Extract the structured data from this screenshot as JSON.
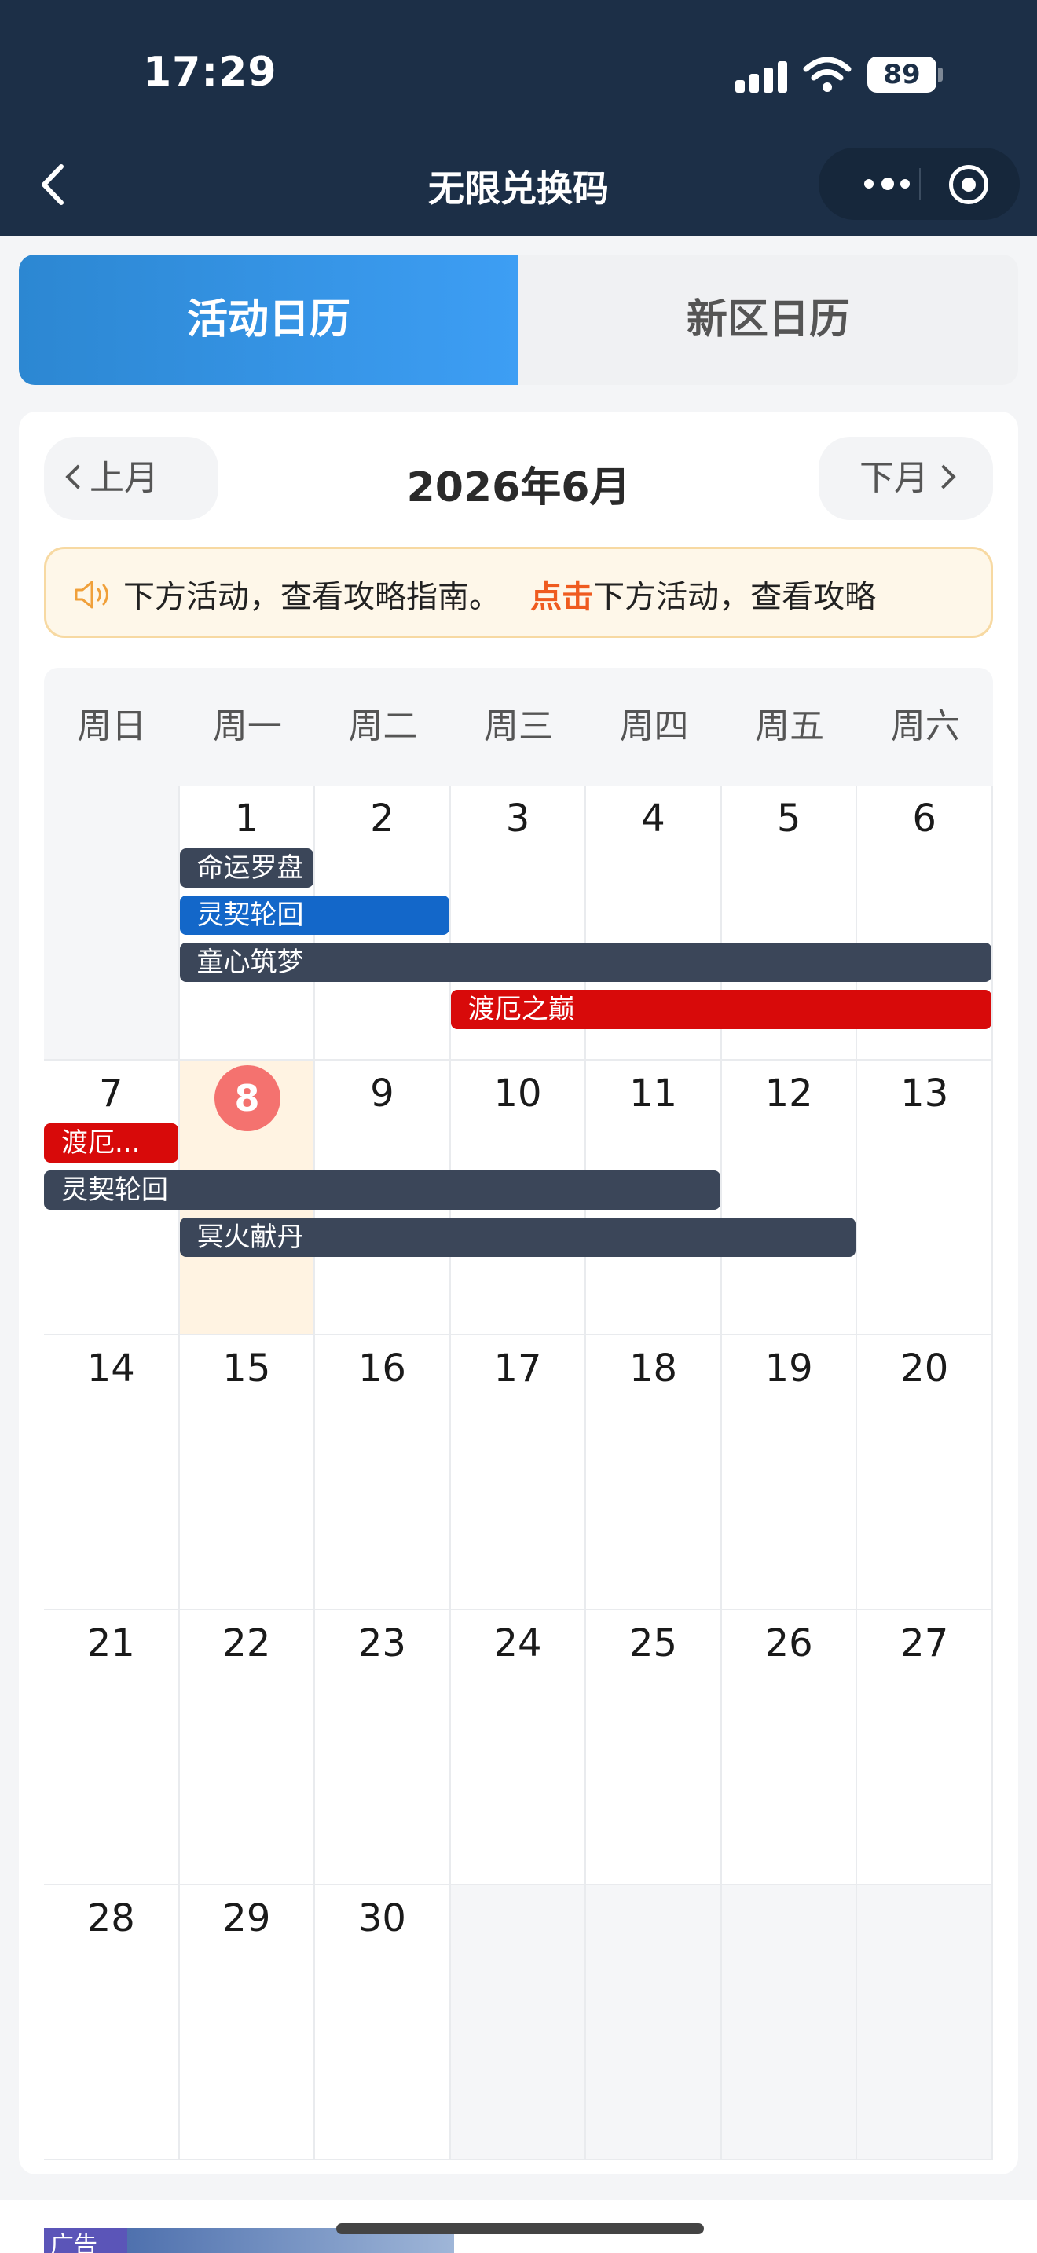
{
  "status": {
    "time": "17:29",
    "battery": "89"
  },
  "nav": {
    "title": "无限兑换码"
  },
  "tabs": [
    {
      "label": "活动日历",
      "active": true
    },
    {
      "label": "新区日历",
      "active": false
    }
  ],
  "calendar": {
    "prev_label": "上月",
    "next_label": "下月",
    "month_title": "2026年6月",
    "notice": {
      "lead": "下方活动，查看攻略指南。",
      "highlight": "点击",
      "tail": "下方活动，查看攻略"
    },
    "weekdays": [
      "周日",
      "周一",
      "周二",
      "周三",
      "周四",
      "周五",
      "周六"
    ],
    "weeks": [
      [
        "",
        "1",
        "2",
        "3",
        "4",
        "5",
        "6"
      ],
      [
        "7",
        "8",
        "9",
        "10",
        "11",
        "12",
        "13"
      ],
      [
        "14",
        "15",
        "16",
        "17",
        "18",
        "19",
        "20"
      ],
      [
        "21",
        "22",
        "23",
        "24",
        "25",
        "26",
        "27"
      ],
      [
        "28",
        "29",
        "30",
        "",
        "",
        "",
        ""
      ]
    ],
    "today": "8",
    "events": [
      {
        "name": "命运罗盘",
        "week": 0,
        "start": 1,
        "end": 2,
        "lane": 0,
        "color": "#3b4659"
      },
      {
        "name": "灵契轮回",
        "week": 0,
        "start": 1,
        "end": 3,
        "lane": 1,
        "color": "#1367c9"
      },
      {
        "name": "童心筑梦",
        "week": 0,
        "start": 1,
        "end": 7,
        "lane": 2,
        "color": "#3b4659"
      },
      {
        "name": "渡厄之巅",
        "week": 0,
        "start": 3,
        "end": 7,
        "lane": 3,
        "color": "#d80a0a"
      },
      {
        "name": "渡厄...",
        "week": 1,
        "start": 0,
        "end": 1,
        "lane": 0,
        "color": "#d80a0a"
      },
      {
        "name": "灵契轮回",
        "week": 1,
        "start": 0,
        "end": 5,
        "lane": 1,
        "color": "#3b4659"
      },
      {
        "name": "冥火献丹",
        "week": 1,
        "start": 1,
        "end": 6,
        "lane": 2,
        "color": "#3b4659"
      }
    ]
  },
  "ad": {
    "label": "广告"
  }
}
